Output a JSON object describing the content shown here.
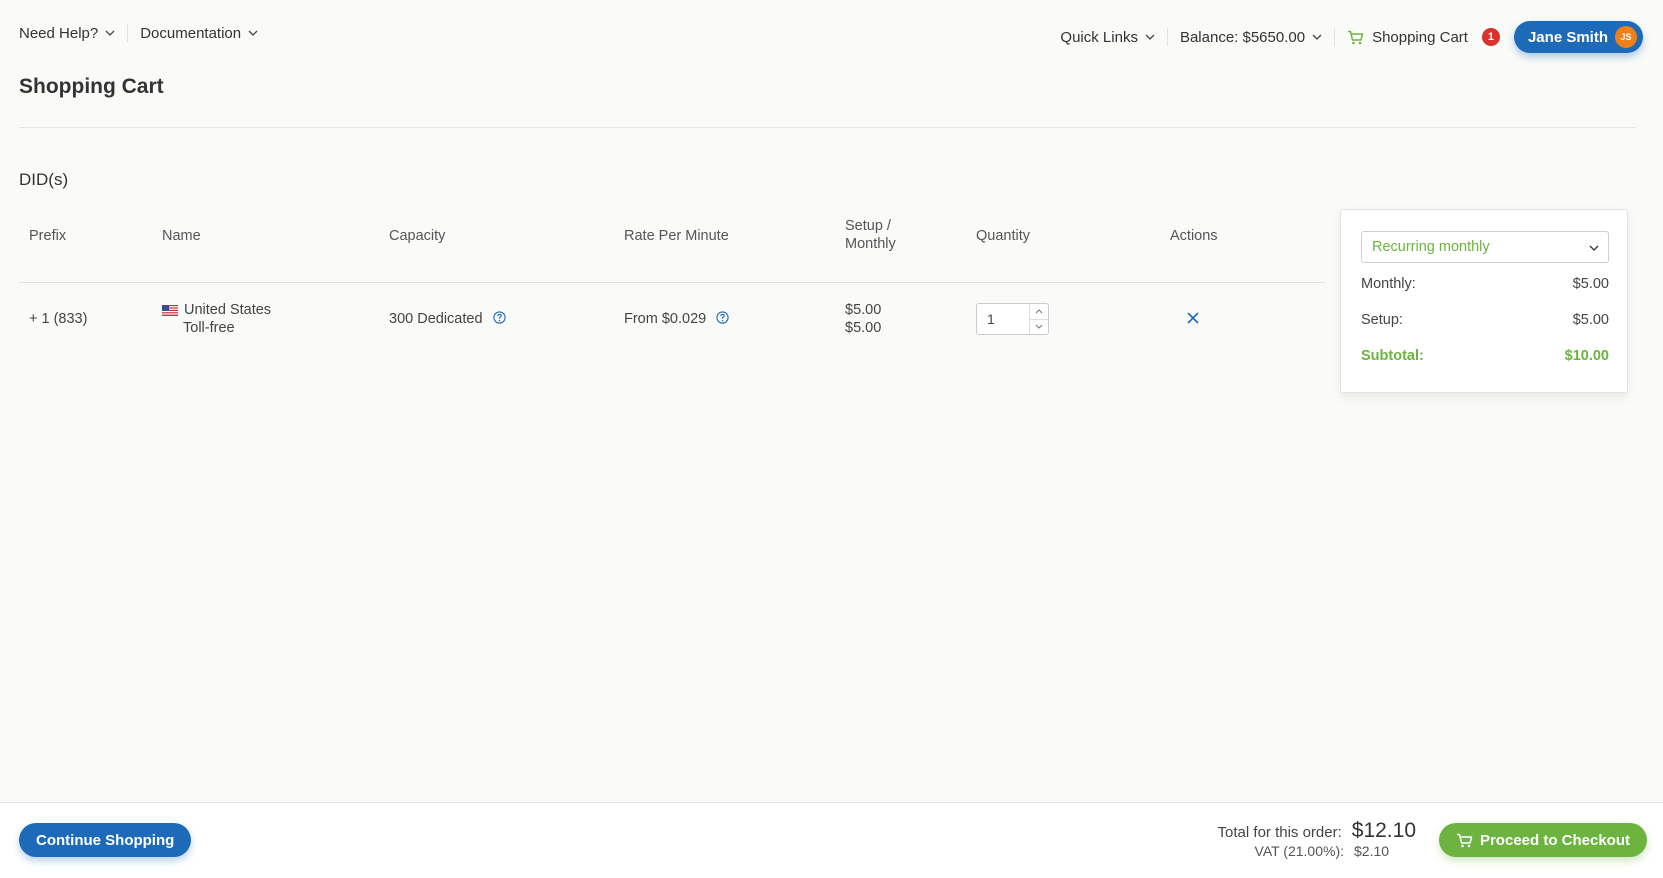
{
  "topbar": {
    "need_help": "Need Help?",
    "documentation": "Documentation",
    "quick_links": "Quick Links",
    "balance": "Balance: $5650.00",
    "cart_label": "Shopping Cart",
    "cart_count": "1",
    "user_name": "Jane Smith",
    "user_initials": "JS"
  },
  "page": {
    "title": "Shopping Cart",
    "section": "DID(s)"
  },
  "table": {
    "headers": {
      "prefix": "Prefix",
      "name": "Name",
      "capacity": "Capacity",
      "rate": "Rate Per Minute",
      "setup_line1": "Setup /",
      "setup_line2": "Monthly",
      "quantity": "Quantity",
      "actions": "Actions"
    },
    "rows": [
      {
        "prefix": "+ 1 (833)",
        "name_line1": "United States",
        "name_line2": "Toll-free",
        "capacity": "300 Dedicated",
        "rate": "From $0.029",
        "setup": "$5.00",
        "monthly": "$5.00",
        "quantity": "1"
      }
    ]
  },
  "summary": {
    "billing_period": "Recurring monthly",
    "monthly_label": "Monthly:",
    "monthly_value": "$5.00",
    "setup_label": "Setup:",
    "setup_value": "$5.00",
    "subtotal_label": "Subtotal:",
    "subtotal_value": "$10.00"
  },
  "footer": {
    "continue_label": "Continue Shopping",
    "total_label": "Total for this order:",
    "total_value": "$12.10",
    "vat_label": "VAT (21.00%):",
    "vat_value": "$2.10",
    "checkout_label": "Proceed to Checkout"
  },
  "colors": {
    "primary": "#1d6bb8",
    "success": "#6db33f",
    "badge": "#d9342b",
    "avatar": "#f07f1a"
  }
}
